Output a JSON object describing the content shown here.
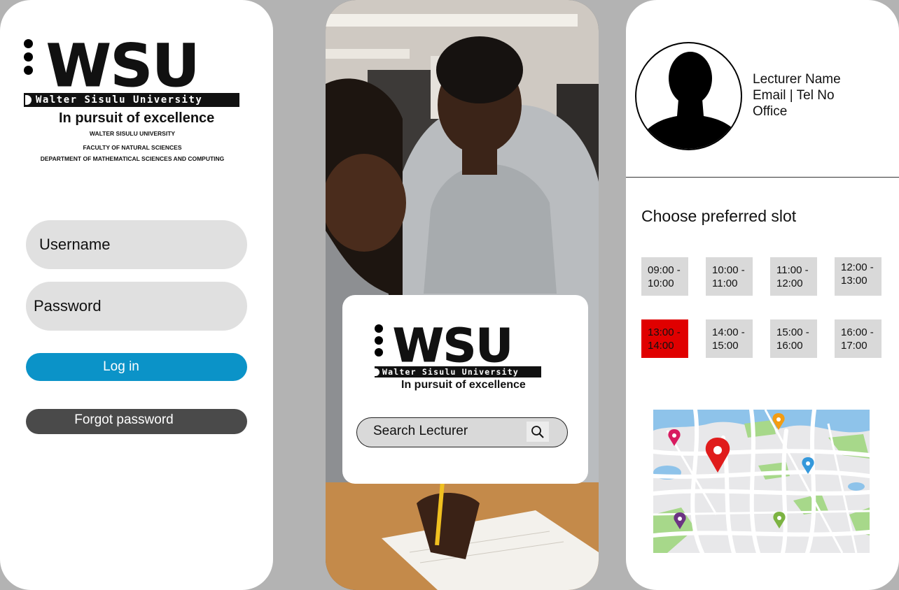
{
  "login": {
    "logo": {
      "brand": "WSU",
      "university": "Walter Sisulu University",
      "tagline": "In pursuit of excellence"
    },
    "faculty_lines": [
      "WALTER SISULU UNIVERSITY",
      "FACULTY OF NATURAL SCIENCES",
      "DEPARTMENT OF MATHEMATICAL SCIENCES AND COMPUTING"
    ],
    "username_placeholder": "Username",
    "password_placeholder": "Password",
    "login_label": "Log in",
    "forgot_label": "Forgot password",
    "login_color": "#0b93c8"
  },
  "search": {
    "logo": {
      "brand": "WSU",
      "university": "Walter Sisulu University",
      "tagline": "In pursuit of excellence"
    },
    "search_placeholder": "Search Lecturer",
    "search_icon": "search-icon"
  },
  "booking": {
    "lecturer_name": "Lecturer Name",
    "contact": "Email | Tel No",
    "office": "Office",
    "section_title": "Choose preferred slot",
    "slots": [
      {
        "start": "09:00 -",
        "end": "10:00",
        "selected": false
      },
      {
        "start": "10:00 -",
        "end": "11:00",
        "selected": false
      },
      {
        "start": "11:00 -",
        "end": "12:00",
        "selected": false
      },
      {
        "start": "12:00 -",
        "end": "13:00",
        "selected": false
      },
      {
        "start": "13:00 -",
        "end": "14:00",
        "selected": true
      },
      {
        "start": "14:00 -",
        "end": "15:00",
        "selected": false
      },
      {
        "start": "15:00 -",
        "end": "16:00",
        "selected": false
      },
      {
        "start": "16:00 -",
        "end": "17:00",
        "selected": false
      }
    ],
    "selected_color": "#e00000",
    "map_icon": "map-pin-icon"
  }
}
